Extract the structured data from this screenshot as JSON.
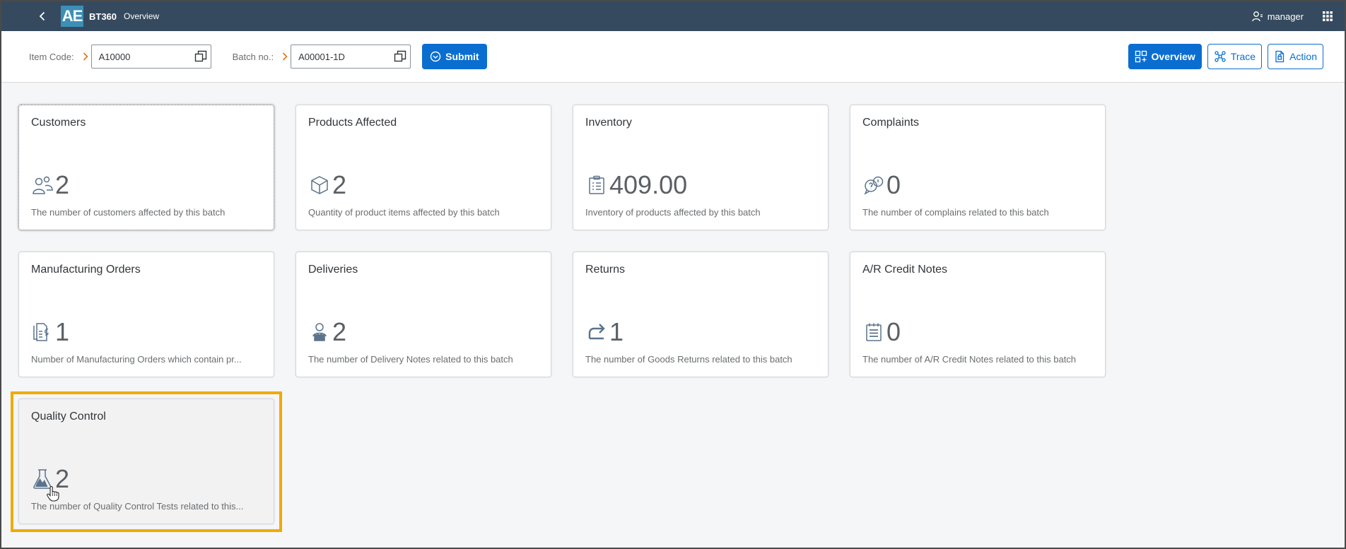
{
  "shell": {
    "logo": "AE",
    "app_name": "BT360",
    "app_sub": "Overview",
    "user": "manager"
  },
  "toolbar": {
    "item_code_label": "Item Code:",
    "item_code_value": "A10000",
    "batch_label": "Batch no.:",
    "batch_value": "A00001-1D",
    "submit_label": "Submit",
    "overview_label": "Overview",
    "trace_label": "Trace",
    "action_label": "Action"
  },
  "tiles": [
    {
      "title": "Customers",
      "value": "2",
      "icon": "customers-icon",
      "footer": "The number of customers affected by this batch"
    },
    {
      "title": "Products Affected",
      "value": "2",
      "icon": "product-box-icon",
      "footer": "Quantity of product items affected by this batch"
    },
    {
      "title": "Inventory",
      "value": "409.00",
      "icon": "clipboard-icon",
      "footer": "Inventory of products affected by this batch"
    },
    {
      "title": "Complaints",
      "value": "0",
      "icon": "complaint-bubble-icon",
      "footer": "The number of complains related to this batch"
    },
    {
      "title": "Manufacturing Orders",
      "value": "1",
      "icon": "manufacturing-document-icon",
      "footer": "Number of Manufacturing Orders which contain pr..."
    },
    {
      "title": "Deliveries",
      "value": "2",
      "icon": "delivery-person-icon",
      "footer": "The number of Delivery Notes related to this batch"
    },
    {
      "title": "Returns",
      "value": "1",
      "icon": "return-arrow-icon",
      "footer": "The number of Goods Returns related to this batch"
    },
    {
      "title": "A/R Credit Notes",
      "value": "0",
      "icon": "credit-note-icon",
      "footer": "The number of A/R Credit Notes related to this batch"
    },
    {
      "title": "Quality Control",
      "value": "2",
      "icon": "lab-flask-icon",
      "footer": "The number of Quality Control Tests related to this..."
    }
  ]
}
